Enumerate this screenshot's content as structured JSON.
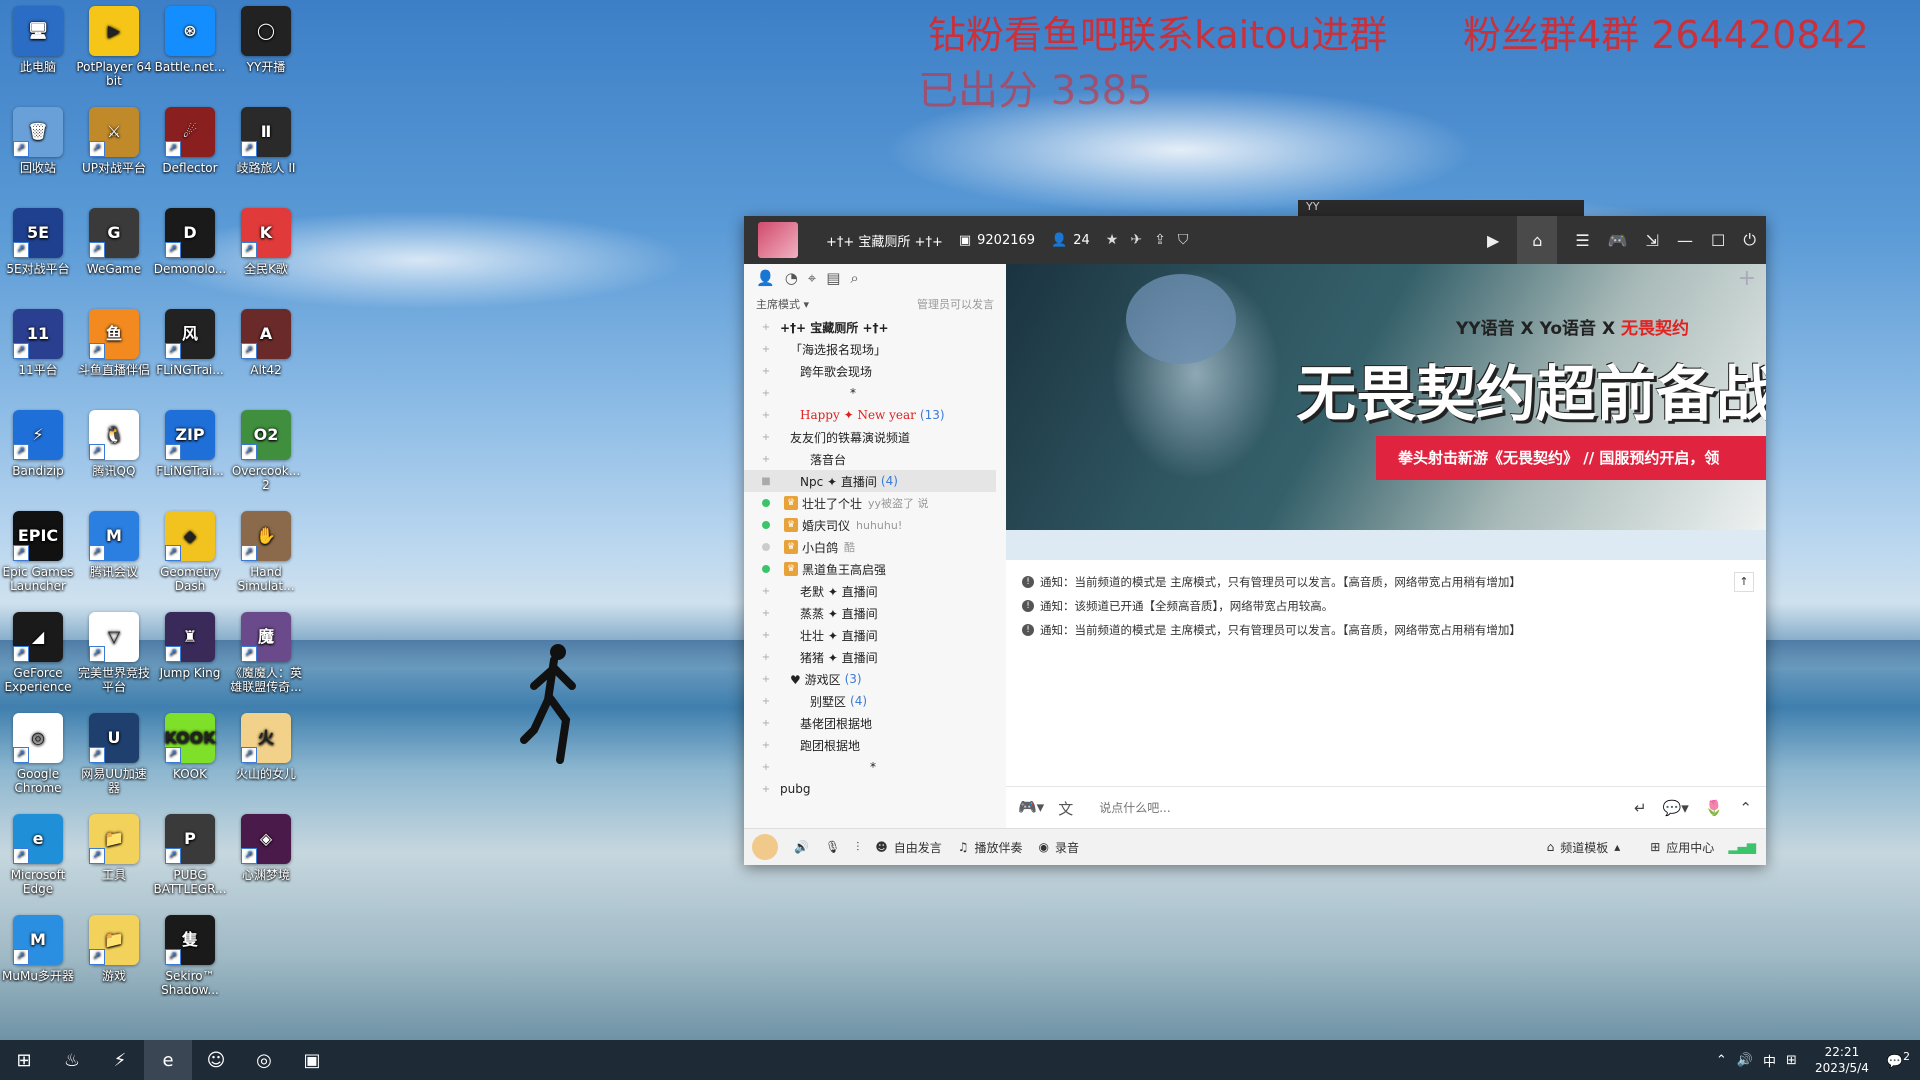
{
  "overlay": {
    "line1": "钻粉看鱼吧联系kaitou进群",
    "line2": "粉丝群4群 264420842",
    "line3": "已出分 3385"
  },
  "desktop_icons": [
    {
      "label": "此电脑",
      "color": "#2b6cc4",
      "glyph": "🖥"
    },
    {
      "label": "PotPlayer 64 bit",
      "color": "#f5c518",
      "glyph": "▶"
    },
    {
      "label": "Battle.net...",
      "color": "#148eff",
      "glyph": "⊛"
    },
    {
      "label": "YY开播",
      "color": "#222222",
      "glyph": "◯"
    },
    {
      "label": "回收站",
      "color": "#6aa0d8",
      "glyph": "🗑"
    },
    {
      "label": "UP对战平台",
      "color": "#c08a2a",
      "glyph": "⚔"
    },
    {
      "label": "Deflector",
      "color": "#8a1f1f",
      "glyph": "☄"
    },
    {
      "label": "歧路旅人 II",
      "color": "#2a2a2a",
      "glyph": "Ⅱ"
    },
    {
      "label": "5E对战平台",
      "color": "#1f3f8f",
      "glyph": "5E"
    },
    {
      "label": "WeGame",
      "color": "#3a3a3a",
      "glyph": "G"
    },
    {
      "label": "Demonolo...",
      "color": "#1a1a1a",
      "glyph": "D"
    },
    {
      "label": "全民K歌",
      "color": "#e03a3a",
      "glyph": "K"
    },
    {
      "label": "11平台",
      "color": "#2a3f8f",
      "glyph": "11"
    },
    {
      "label": "斗鱼直播伴侣",
      "color": "#f28a1f",
      "glyph": "鱼"
    },
    {
      "label": "FLiNGTrai...",
      "color": "#222222",
      "glyph": "风"
    },
    {
      "label": "Alt42",
      "color": "#6b2a2a",
      "glyph": "A"
    },
    {
      "label": "Bandizip",
      "color": "#1f6fd8",
      "glyph": "⚡"
    },
    {
      "label": "腾讯QQ",
      "color": "#ffffff",
      "glyph": "🐧"
    },
    {
      "label": "FLiNGTrai...",
      "color": "#1f6fd8",
      "glyph": "ZIP"
    },
    {
      "label": "Overcook... 2",
      "color": "#3f8f3f",
      "glyph": "O2"
    },
    {
      "label": "Epic Games Launcher",
      "color": "#111111",
      "glyph": "EPIC"
    },
    {
      "label": "腾讯会议",
      "color": "#2a7fe0",
      "glyph": "M"
    },
    {
      "label": "Geometry Dash",
      "color": "#f2c21f",
      "glyph": "◆"
    },
    {
      "label": "Hand Simulat...",
      "color": "#8a6a4a",
      "glyph": "✋"
    },
    {
      "label": "GeForce Experience",
      "color": "#1a1a1a",
      "glyph": "◢"
    },
    {
      "label": "完美世界竞技平台",
      "color": "#ffffff",
      "glyph": "▽"
    },
    {
      "label": "Jump King",
      "color": "#3a2a5a",
      "glyph": "♜"
    },
    {
      "label": "《魔魔人：英雄联盟传奇...",
      "color": "#6a4a8a",
      "glyph": "魔"
    },
    {
      "label": "Google Chrome",
      "color": "#ffffff",
      "glyph": "◎"
    },
    {
      "label": "网易UU加速器",
      "color": "#1f3f6f",
      "glyph": "U"
    },
    {
      "label": "KOOK",
      "color": "#7fe02a",
      "glyph": "KOOK"
    },
    {
      "label": "火山的女儿",
      "color": "#f2d28a",
      "glyph": "火"
    },
    {
      "label": "Microsoft Edge",
      "color": "#1f8fd8",
      "glyph": "e"
    },
    {
      "label": "工具",
      "color": "#f2d25a",
      "glyph": "📁"
    },
    {
      "label": "PUBG BATTLEGR...",
      "color": "#3a3a3a",
      "glyph": "P"
    },
    {
      "label": "心渊梦境",
      "color": "#4a1a4a",
      "glyph": "◈"
    },
    {
      "label": "MuMu多开器",
      "color": "#2a8fe0",
      "glyph": "M"
    },
    {
      "label": "游戏",
      "color": "#f2d25a",
      "glyph": "📁"
    },
    {
      "label": "Sekiro™ Shadow...",
      "color": "#1a1a1a",
      "glyph": "隻"
    }
  ],
  "yy": {
    "ghost_title": "YY",
    "channel_name": "+†+ 宝藏厕所 +†+",
    "channel_id": "9202169",
    "user_count": "24",
    "left_mode": "主席模式",
    "left_admin": "管理员可以发言",
    "tree": [
      {
        "text": "+†+ 宝藏厕所 +†+",
        "indent": 0,
        "bold": true,
        "count": ""
      },
      {
        "text": "「海选报名现场」",
        "indent": 1,
        "count": ""
      },
      {
        "text": "跨年歌会现场",
        "indent": 2,
        "count": ""
      },
      {
        "text": "*",
        "indent": 7,
        "count": ""
      },
      {
        "text": "Happy ✦ New year",
        "indent": 2,
        "count": "(13)",
        "red": true
      },
      {
        "text": "友友们的铁幕演说频道",
        "indent": 1,
        "count": ""
      },
      {
        "text": "落音台",
        "indent": 3,
        "count": ""
      },
      {
        "text": "Npc ✦ 直播间",
        "indent": 2,
        "count": "(4)",
        "selected": true
      },
      {
        "user": true,
        "text": "壮壮了个壮",
        "msg": "yy被盗了 说"
      },
      {
        "user": true,
        "text": "婚庆司仪",
        "msg": "huhuhu!"
      },
      {
        "user": true,
        "text": "小白鸽",
        "msg": "酷",
        "grey": true
      },
      {
        "user": true,
        "text": "黑道鱼王高启强",
        "msg": ""
      },
      {
        "text": "老默 ✦ 直播间",
        "indent": 2,
        "count": ""
      },
      {
        "text": "蒸蒸 ✦ 直播间",
        "indent": 2,
        "count": ""
      },
      {
        "text": "壮壮 ✦ 直播间",
        "indent": 2,
        "count": ""
      },
      {
        "text": "猪猪 ✦ 直播间",
        "indent": 2,
        "count": ""
      },
      {
        "text": "♥ 游戏区",
        "indent": 1,
        "count": "(3)"
      },
      {
        "text": "别墅区",
        "indent": 3,
        "count": "(4)"
      },
      {
        "text": "基佬团根据地",
        "indent": 2,
        "count": ""
      },
      {
        "text": "跑团根据地",
        "indent": 2,
        "count": ""
      },
      {
        "text": "*",
        "indent": 9,
        "count": ""
      },
      {
        "text": "pubg",
        "indent": 0,
        "count": ""
      }
    ],
    "banner": {
      "logo1": "YY语音",
      "logo2": "Yo语音",
      "logo3": "无畏契约",
      "x": "X",
      "headline": "无畏契约超前备战",
      "redbar": "拳头射击新游《无畏契约》 // 国服预约开启，领"
    },
    "notices": [
      "通知：当前频道的模式是 主席模式，只有管理员可以发言。【高音质，网络带宽占用稍有增加】",
      "通知：该频道已开通【全频高音质】，网络带宽占用较高。",
      "通知：当前频道的模式是 主席模式，只有管理员可以发言。【高音质，网络带宽占用稍有增加】"
    ],
    "input_placeholder": "说点什么吧...",
    "bottom": {
      "free_speak": "自由发言",
      "play_music": "播放伴奏",
      "record": "录音",
      "template": "频道模板",
      "app_center": "应用中心"
    }
  },
  "taskbar": {
    "time": "22:21",
    "date": "2023/5/4",
    "ime": "中",
    "notif_count": "2"
  }
}
